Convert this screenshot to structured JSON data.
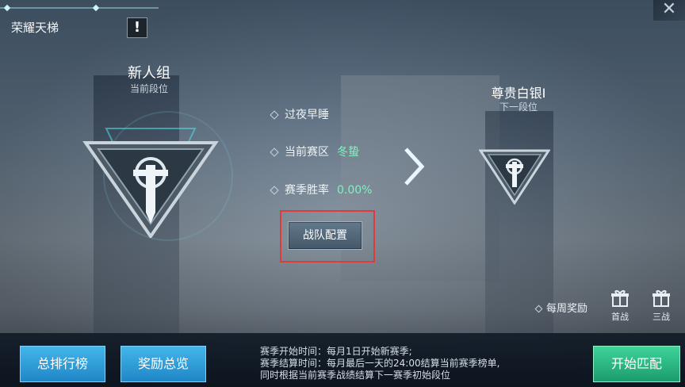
{
  "header": {
    "title": "荣耀天梯",
    "info_glyph": "!",
    "close_glyph": "✕"
  },
  "current_rank": {
    "name": "新人组",
    "subtitle": "当前段位"
  },
  "next_rank": {
    "name": "尊贵白银I",
    "subtitle": "下一段位"
  },
  "stats": [
    {
      "label": "过夜早睡",
      "value": ""
    },
    {
      "label": "当前赛区",
      "value": "冬蛰"
    },
    {
      "label": "赛季胜率",
      "value": "0.00%"
    }
  ],
  "squad_button": "战队配置",
  "weekly_reward": {
    "label": "每周奖励",
    "items": [
      "首战",
      "三战"
    ]
  },
  "footer": {
    "leaderboard_button": "总排行榜",
    "rewards_button": "奖励总览",
    "season_info": [
      "赛季开始时间：每月1日开始新赛季;",
      "赛季结算时间：每月最后一天的24:00结算当前赛季榜单,",
      "同时根据当前赛季战绩结算下一赛季初始段位"
    ],
    "start_button": "开始匹配"
  },
  "colors": {
    "accent_green": "#7ff2c2",
    "highlight_red": "#e03a3a",
    "button_blue": "#2a9ad8",
    "button_green": "#26b47e"
  }
}
